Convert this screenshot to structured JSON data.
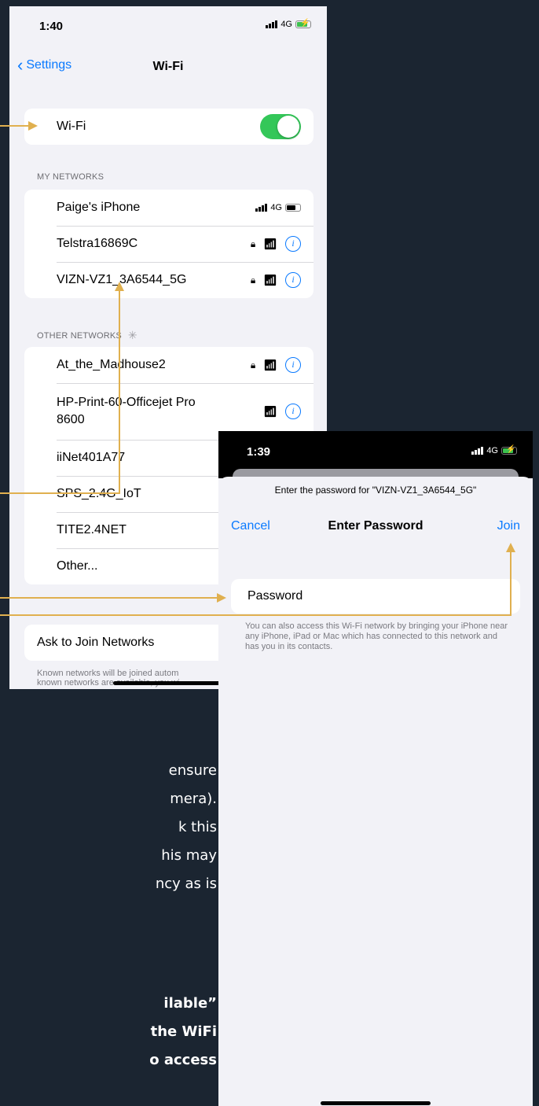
{
  "phone1": {
    "status": {
      "time": "1:40",
      "network": "4G"
    },
    "nav": {
      "back_label": "Settings",
      "title": "Wi-Fi"
    },
    "wifi_row": {
      "label": "Wi-Fi",
      "enabled": true
    },
    "my_networks": {
      "header": "MY NETWORKS",
      "items": [
        {
          "name": "Paige's iPhone",
          "badge": "4G",
          "type": "hotspot"
        },
        {
          "name": "Telstra16869C",
          "secured": true
        },
        {
          "name": "VIZN-VZ1_3A6544_5G",
          "secured": true
        }
      ]
    },
    "other_networks": {
      "header": "OTHER NETWORKS",
      "items": [
        {
          "name": "At_the_Madhouse2",
          "secured": true
        },
        {
          "name": "HP-Print-60-Officejet Pro 8600",
          "secured": false
        },
        {
          "name": "iiNet401A77"
        },
        {
          "name": "SPS_2.4G_IoT"
        },
        {
          "name": "TITE2.4NET"
        },
        {
          "name": "Other..."
        }
      ]
    },
    "ask_to_join": {
      "label": "Ask to Join Networks",
      "description_line1": "Known networks will be joined autom",
      "description_line2": "known networks are available, you wi"
    }
  },
  "phone2": {
    "status": {
      "time": "1:39",
      "network": "4G"
    },
    "prompt": "Enter the password for \"VIZN-VZ1_3A6544_5G\"",
    "cancel_label": "Cancel",
    "title": "Enter Password",
    "join_label": "Join",
    "password_placeholder": "Password",
    "help_text": "You can also access this Wi-Fi network by bringing your iPhone near any iPhone, iPad or Mac which has connected to this network and has you in its contacts."
  },
  "background_text": {
    "regular_lines": [
      "ensure",
      "mera).",
      "k this",
      "his may",
      "ncy as is"
    ],
    "bold_lines": [
      "ilable”",
      "the WiFi",
      "o access"
    ]
  },
  "colors": {
    "background": "#1b2531",
    "arrow": "#e0b04f",
    "ios_blue": "#0a7aff",
    "toggle_green": "#34c759"
  }
}
